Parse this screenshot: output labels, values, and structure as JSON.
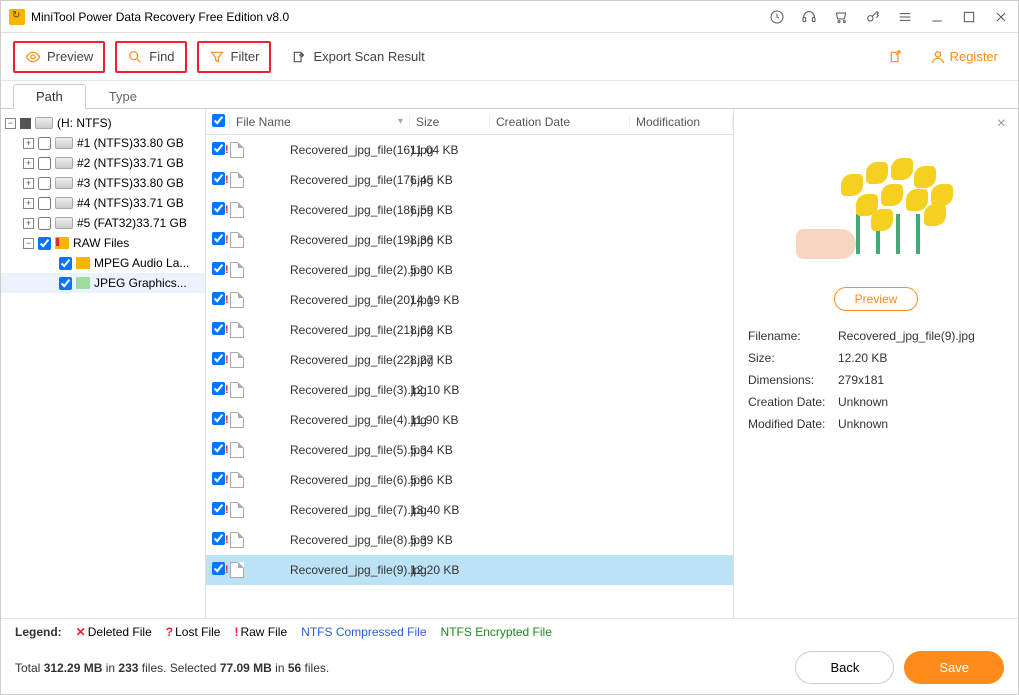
{
  "title": "MiniTool Power Data Recovery Free Edition v8.0",
  "toolbar": {
    "preview": "Preview",
    "find": "Find",
    "filter": "Filter",
    "export": "Export Scan Result",
    "register": "Register"
  },
  "tabs": {
    "path": "Path",
    "type": "Type"
  },
  "tree": {
    "root": "(H: NTFS)",
    "parts": [
      "#1 (NTFS)33.80 GB",
      "#2 (NTFS)33.71 GB",
      "#3 (NTFS)33.80 GB",
      "#4 (NTFS)33.71 GB",
      "#5 (FAT32)33.71 GB"
    ],
    "raw": "RAW Files",
    "raw_children": [
      "MPEG Audio La...",
      "JPEG Graphics..."
    ]
  },
  "columns": {
    "name": "File Name",
    "size": "Size",
    "cdate": "Creation Date",
    "mdate": "Modification"
  },
  "files": [
    {
      "name": "Recovered_jpg_file(16).jpg",
      "size": "11.04 KB"
    },
    {
      "name": "Recovered_jpg_file(17).jpg",
      "size": "6.45 KB"
    },
    {
      "name": "Recovered_jpg_file(18).jpg",
      "size": "6.59 KB"
    },
    {
      "name": "Recovered_jpg_file(19).jpg",
      "size": "8.36 KB"
    },
    {
      "name": "Recovered_jpg_file(2).jpg",
      "size": "5.30 KB"
    },
    {
      "name": "Recovered_jpg_file(20).jpg",
      "size": "14.19 KB"
    },
    {
      "name": "Recovered_jpg_file(21).jpg",
      "size": "8.62 KB"
    },
    {
      "name": "Recovered_jpg_file(22).jpg",
      "size": "8.27 KB"
    },
    {
      "name": "Recovered_jpg_file(3).jpg",
      "size": "12.10 KB"
    },
    {
      "name": "Recovered_jpg_file(4).jpg",
      "size": "11.90 KB"
    },
    {
      "name": "Recovered_jpg_file(5).jpg",
      "size": "5.34 KB"
    },
    {
      "name": "Recovered_jpg_file(6).jpg",
      "size": "5.86 KB"
    },
    {
      "name": "Recovered_jpg_file(7).jpg",
      "size": "13.40 KB"
    },
    {
      "name": "Recovered_jpg_file(8).jpg",
      "size": "5.39 KB"
    },
    {
      "name": "Recovered_jpg_file(9).jpg",
      "size": "12.20 KB",
      "selected": true
    }
  ],
  "preview": {
    "button": "Preview",
    "labels": {
      "filename": "Filename:",
      "size": "Size:",
      "dim": "Dimensions:",
      "cdate": "Creation Date:",
      "mdate": "Modified Date:"
    },
    "filename": "Recovered_jpg_file(9).jpg",
    "size": "12.20 KB",
    "dim": "279x181",
    "cdate": "Unknown",
    "mdate": "Unknown"
  },
  "legend": {
    "title": "Legend:",
    "deleted": "Deleted File",
    "lost": "Lost File",
    "raw": "Raw File",
    "ntfs": "NTFS Compressed File",
    "enc": "NTFS Encrypted File"
  },
  "footer": {
    "total_pre": "Total ",
    "total_mb": "312.29 MB",
    "total_mid": " in ",
    "total_files": "233",
    "total_post": " files.  Selected ",
    "sel_mb": "77.09 MB",
    "sel_mid": " in ",
    "sel_files": "56",
    "sel_post": " files.",
    "back": "Back",
    "save": "Save"
  }
}
